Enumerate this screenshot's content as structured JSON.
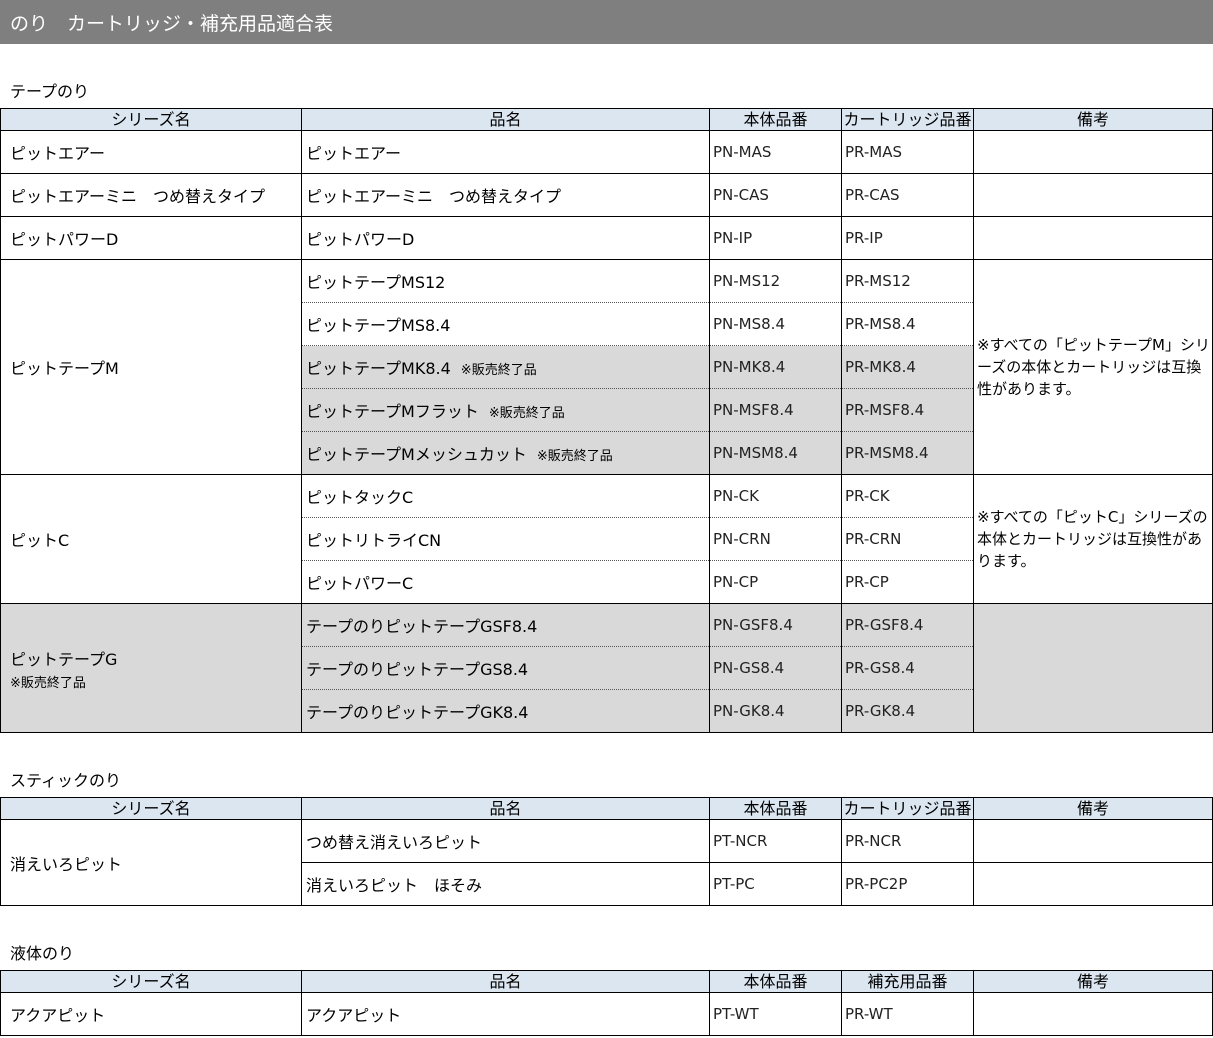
{
  "page_title": "のり　カートリッジ・補充用品適合表",
  "headers": [
    "シリーズ名",
    "品名",
    "本体品番",
    "カートリッジ品番",
    "備考"
  ],
  "headers_liquid": [
    "シリーズ名",
    "品名",
    "本体品番",
    "補充用品番",
    "備考"
  ],
  "tape": {
    "title": "テープのり",
    "rows": [
      {
        "series": "ピットエアー",
        "name": "ピットエアー",
        "body": "PN-MAS",
        "cart": "PR-MAS"
      },
      {
        "series": "ピットエアーミニ　つめ替えタイプ",
        "name": "ピットエアーミニ　つめ替えタイプ",
        "body": "PN-CAS",
        "cart": "PR-CAS"
      },
      {
        "series": "ピットパワーD",
        "name": "ピットパワーD",
        "body": "PN-IP",
        "cart": "PR-IP"
      }
    ],
    "group_m": {
      "series": "ピットテープM",
      "note": "※すべての「ピットテープM」シリーズの本体とカートリッジは互換性があります。",
      "rows": [
        {
          "name": "ピットテープMS12",
          "tag": "",
          "body": "PN-MS12",
          "cart": "PR-MS12"
        },
        {
          "name": "ピットテープMS8.4",
          "tag": "",
          "body": "PN-MS8.4",
          "cart": "PR-MS8.4"
        },
        {
          "name": "ピットテープMK8.4",
          "tag": "※販売終了品",
          "body": "PN-MK8.4",
          "cart": "PR-MK8.4"
        },
        {
          "name": "ピットテープMフラット",
          "tag": "※販売終了品",
          "body": "PN-MSF8.4",
          "cart": "PR-MSF8.4"
        },
        {
          "name": "ピットテープMメッシュカット",
          "tag": "※販売終了品",
          "body": "PN-MSM8.4",
          "cart": "PR-MSM8.4"
        }
      ]
    },
    "group_c": {
      "series": "ピットC",
      "note": "※すべての「ピットC」シリーズの本体とカートリッジは互換性があります。",
      "rows": [
        {
          "name": "ピットタックC",
          "body": "PN-CK",
          "cart": "PR-CK"
        },
        {
          "name": "ピットリトライCN",
          "body": "PN-CRN",
          "cart": "PR-CRN"
        },
        {
          "name": "ピットパワーC",
          "body": "PN-CP",
          "cart": "PR-CP"
        }
      ]
    },
    "group_g": {
      "series": "ピットテープG",
      "series_tag": "※販売終了品",
      "rows": [
        {
          "name": "テープのりピットテープGSF8.4",
          "body": "PN-GSF8.4",
          "cart": "PR-GSF8.4"
        },
        {
          "name": "テープのりピットテープGS8.4",
          "body": "PN-GS8.4",
          "cart": "PR-GS8.4"
        },
        {
          "name": "テープのりピットテープGK8.4",
          "body": "PN-GK8.4",
          "cart": "PR-GK8.4"
        }
      ]
    }
  },
  "stick": {
    "title": "スティックのり",
    "series": "消えいろピット",
    "rows": [
      {
        "name": "つめ替え消えいろピット",
        "body": "PT-NCR",
        "cart": "PR-NCR"
      },
      {
        "name": "消えいろピット　ほそみ",
        "body": "PT-PC",
        "cart": "PR-PC2P"
      }
    ]
  },
  "liquid": {
    "title": "液体のり",
    "rows": [
      {
        "series": "アクアピット",
        "name": "アクアピット",
        "body": "PT-WT",
        "cart": "PR-WT"
      }
    ]
  },
  "colors": {
    "title_bg": "#7f7f7f",
    "header_bg": "#dce6f1",
    "discontinued_bg": "#d9d9d9"
  }
}
